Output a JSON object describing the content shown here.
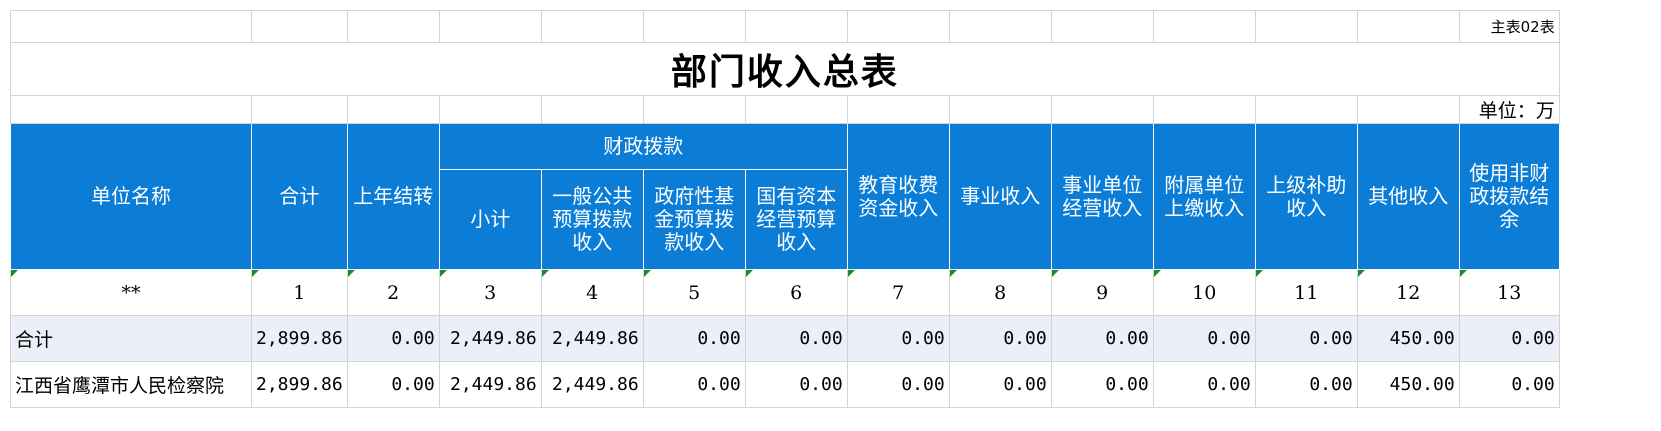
{
  "table_code": "主表02表",
  "title": "部门收入总表",
  "unit_label": "单位：万",
  "headers": {
    "unit_name": "单位名称",
    "total": "合计",
    "last_year_carryover": "上年结转",
    "fiscal_group": "财政拨款",
    "fiscal_subtotal": "小计",
    "fiscal_general": "一般公共预算拨款收入",
    "fiscal_fund": "政府性基金预算拨款收入",
    "fiscal_state_capital": "国有资本经营预算收入",
    "education_fee": "教育收费资金收入",
    "business_income": "事业收入",
    "operating_income": "事业单位经营收入",
    "subordinate_income": "附属单位上缴收入",
    "superior_subsidy": "上级补助收入",
    "other_income": "其他收入",
    "non_fiscal_balance": "使用非财政拨款结余"
  },
  "index_row": [
    "**",
    "1",
    "2",
    "3",
    "4",
    "5",
    "6",
    "7",
    "8",
    "9",
    "10",
    "11",
    "12",
    "13"
  ],
  "rows": [
    {
      "name": "合计",
      "values": [
        "2,899.86",
        "0.00",
        "2,449.86",
        "2,449.86",
        "0.00",
        "0.00",
        "0.00",
        "0.00",
        "0.00",
        "0.00",
        "0.00",
        "450.00",
        "0.00"
      ]
    },
    {
      "name": "江西省鹰潭市人民检察院",
      "values": [
        "2,899.86",
        "0.00",
        "2,449.86",
        "2,449.86",
        "0.00",
        "0.00",
        "0.00",
        "0.00",
        "0.00",
        "0.00",
        "0.00",
        "450.00",
        "0.00"
      ]
    }
  ]
}
